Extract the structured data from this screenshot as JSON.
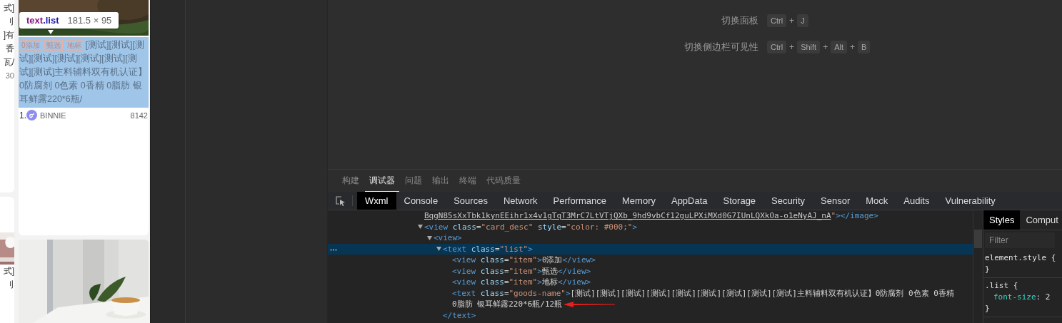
{
  "simulator": {
    "left_column": {
      "top_texts": [
        "式]",
        "刂",
        "]有",
        "香",
        "瓦/",
        "30"
      ],
      "bottom_texts": [
        "式]",
        "刂"
      ]
    },
    "product_card": {
      "tooltip": {
        "element": "text",
        "selector": ".list",
        "size": "181.5 × 95"
      },
      "highlighted": true,
      "tags": [
        "0添加",
        "甄选",
        "地标"
      ],
      "description": "[测试][测试][测试][测试][测试][测试][测试][测试][测试]主料辅料双有机认证】0防腐剂 0色素 0香精 0脂肪 银耳鲜露220*6瓶/",
      "rank": "1.",
      "author": "BINNIE",
      "count": "8142"
    }
  },
  "shortcuts": [
    {
      "label": "切换面板",
      "keys": [
        {
          "kind": "key",
          "text": "Ctrl"
        },
        {
          "kind": "plus",
          "text": "+"
        },
        {
          "kind": "key",
          "text": "J"
        }
      ]
    },
    {
      "label": "切换侧边栏可见性",
      "keys": [
        {
          "kind": "key",
          "text": "Ctrl"
        },
        {
          "kind": "plus",
          "text": "+"
        },
        {
          "kind": "key",
          "text": "Shift"
        },
        {
          "kind": "plus",
          "text": "+"
        },
        {
          "kind": "key",
          "text": "Alt"
        },
        {
          "kind": "plus",
          "text": "+"
        },
        {
          "kind": "key",
          "text": "B"
        }
      ]
    }
  ],
  "panel_tabs": [
    {
      "label": "构建",
      "selected": false
    },
    {
      "label": "调试器",
      "selected": true
    },
    {
      "label": "问题",
      "selected": false
    },
    {
      "label": "输出",
      "selected": false
    },
    {
      "label": "终端",
      "selected": false
    },
    {
      "label": "代码质量",
      "selected": false
    }
  ],
  "devtools_tabs": [
    {
      "label": "Wxml",
      "selected": true
    },
    {
      "label": "Console",
      "selected": false
    },
    {
      "label": "Sources",
      "selected": false
    },
    {
      "label": "Network",
      "selected": false
    },
    {
      "label": "Performance",
      "selected": false
    },
    {
      "label": "Memory",
      "selected": false
    },
    {
      "label": "AppData",
      "selected": false
    },
    {
      "label": "Storage",
      "selected": false
    },
    {
      "label": "Security",
      "selected": false
    },
    {
      "label": "Sensor",
      "selected": false
    },
    {
      "label": "Mock",
      "selected": false
    },
    {
      "label": "Audits",
      "selected": false
    },
    {
      "label": "Vulnerability",
      "selected": false
    }
  ],
  "wxml_tree": [
    {
      "selected": false,
      "lines": [
        [
          {
            "kind": "link",
            "text": "BqgN85sXxTbk1kynEEihr1x4v1gTqT3MrC7LtVTjQXb_9hd9vbCf12guLPXiMXd0G7IUnLQXkOa-o1eNyAJ_nA"
          },
          {
            "kind": "value",
            "text": "\""
          },
          {
            "kind": "tag",
            "text": "></image>"
          }
        ]
      ]
    },
    {
      "selected": false,
      "expanded": true,
      "lines": [
        [
          {
            "kind": "tag",
            "text": "<view"
          },
          {
            "kind": "attr",
            "text": " class"
          },
          {
            "kind": "punct",
            "text": "="
          },
          {
            "kind": "value",
            "text": "\"card_desc\""
          },
          {
            "kind": "attr",
            "text": " style"
          },
          {
            "kind": "punct",
            "text": "="
          },
          {
            "kind": "value",
            "text": "\"color: #000;\""
          },
          {
            "kind": "tag",
            "text": ">"
          }
        ]
      ],
      "children": [
        {
          "selected": false,
          "expanded": true,
          "lines": [
            [
              {
                "kind": "tag",
                "text": "<view>"
              }
            ]
          ],
          "children": [
            {
              "selected": true,
              "expanded": true,
              "lines": [
                [
                  {
                    "kind": "tag",
                    "text": "<text"
                  },
                  {
                    "kind": "attr",
                    "text": " class"
                  },
                  {
                    "kind": "punct",
                    "text": "="
                  },
                  {
                    "kind": "value",
                    "text": "\"list\""
                  },
                  {
                    "kind": "tag",
                    "text": ">"
                  }
                ]
              ],
              "children": [
                {
                  "selected": false,
                  "lines": [
                    [
                      {
                        "kind": "tag",
                        "text": "<view"
                      },
                      {
                        "kind": "attr",
                        "text": " class"
                      },
                      {
                        "kind": "punct",
                        "text": "="
                      },
                      {
                        "kind": "value",
                        "text": "\"item\""
                      },
                      {
                        "kind": "tag",
                        "text": ">"
                      },
                      {
                        "kind": "text",
                        "text": "0添加"
                      },
                      {
                        "kind": "tag",
                        "text": "</view>"
                      }
                    ]
                  ]
                },
                {
                  "selected": false,
                  "lines": [
                    [
                      {
                        "kind": "tag",
                        "text": "<view"
                      },
                      {
                        "kind": "attr",
                        "text": " class"
                      },
                      {
                        "kind": "punct",
                        "text": "="
                      },
                      {
                        "kind": "value",
                        "text": "\"item\""
                      },
                      {
                        "kind": "tag",
                        "text": ">"
                      },
                      {
                        "kind": "text",
                        "text": "甄选"
                      },
                      {
                        "kind": "tag",
                        "text": "</view>"
                      }
                    ]
                  ]
                },
                {
                  "selected": false,
                  "lines": [
                    [
                      {
                        "kind": "tag",
                        "text": "<view"
                      },
                      {
                        "kind": "attr",
                        "text": " class"
                      },
                      {
                        "kind": "punct",
                        "text": "="
                      },
                      {
                        "kind": "value",
                        "text": "\"item\""
                      },
                      {
                        "kind": "tag",
                        "text": ">"
                      },
                      {
                        "kind": "text",
                        "text": "地标"
                      },
                      {
                        "kind": "tag",
                        "text": "</view>"
                      }
                    ]
                  ]
                },
                {
                  "selected": false,
                  "arrow": true,
                  "lines": [
                    [
                      {
                        "kind": "tag",
                        "text": "<text"
                      },
                      {
                        "kind": "attr",
                        "text": " class"
                      },
                      {
                        "kind": "punct",
                        "text": "="
                      },
                      {
                        "kind": "value",
                        "text": "\"goods-name\""
                      },
                      {
                        "kind": "tag",
                        "text": ">"
                      },
                      {
                        "kind": "text",
                        "text": "[测试][测试][测试][测试][测试][测试][测试][测试][测试]主料辅料双有机认证】0防腐剂 0色素 0香精"
                      }
                    ],
                    [
                      {
                        "kind": "text",
                        "text": "0脂肪 银耳鲜露220*6瓶/12瓶"
                      }
                    ]
                  ]
                }
              ],
              "closing": [
                {
                  "kind": "tag",
                  "text": "</text>"
                }
              ]
            }
          ]
        }
      ]
    }
  ],
  "styles_pane": {
    "tabs": [
      {
        "label": "Styles",
        "selected": true
      },
      {
        "label": "Comput",
        "selected": false
      }
    ],
    "filter_placeholder": "Filter",
    "rules": [
      {
        "lines": [
          {
            "kind": "selector",
            "text": "element.style {"
          },
          {
            "kind": "brace",
            "text": "}"
          }
        ]
      },
      {
        "lines": [
          {
            "kind": "selector",
            "text": ".list {"
          },
          {
            "kind": "declaration",
            "property": "font-size",
            "value": ": 2"
          },
          {
            "kind": "brace",
            "text": "}"
          }
        ]
      }
    ]
  }
}
